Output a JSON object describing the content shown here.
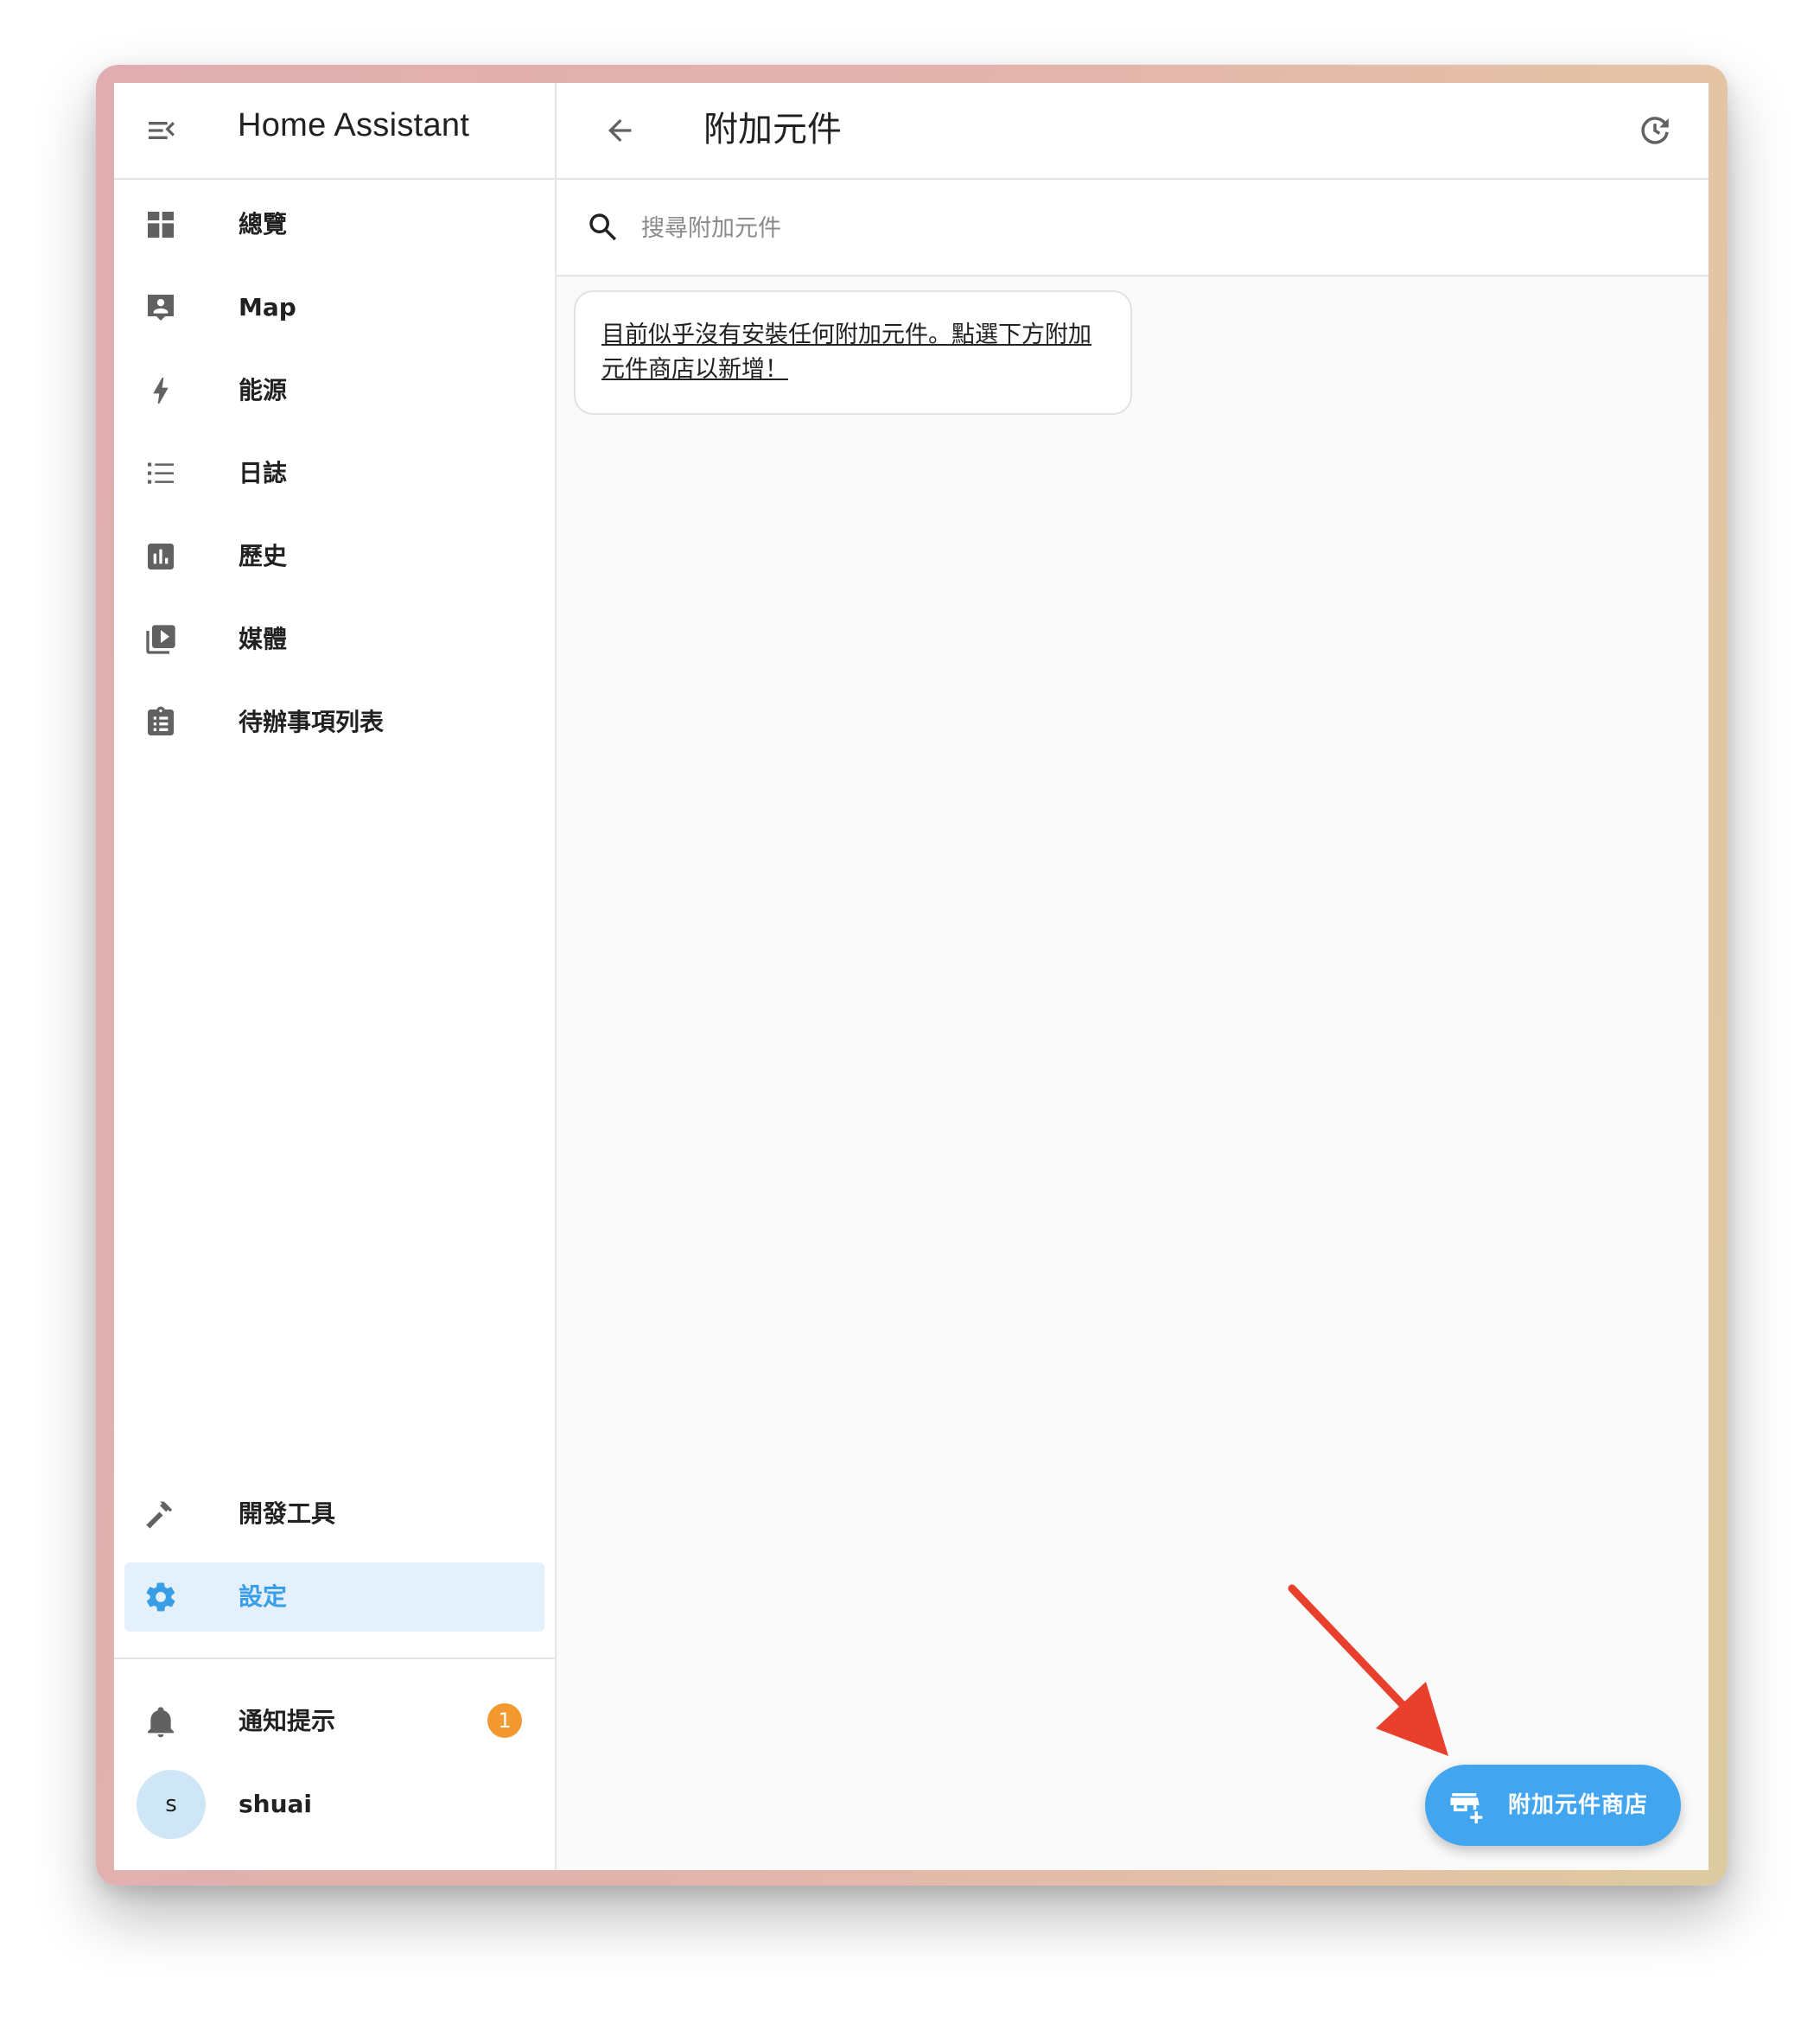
{
  "sidebar": {
    "title": "Home Assistant",
    "items": [
      {
        "label": "總覽",
        "icon": "dashboard-icon"
      },
      {
        "label": "Map",
        "icon": "map-account-icon"
      },
      {
        "label": "能源",
        "icon": "lightning-bolt-icon"
      },
      {
        "label": "日誌",
        "icon": "format-list-bulleted-icon"
      },
      {
        "label": "歷史",
        "icon": "chart-box-icon"
      },
      {
        "label": "媒體",
        "icon": "play-box-multiple-icon"
      },
      {
        "label": "待辦事項列表",
        "icon": "clipboard-list-icon"
      }
    ],
    "bottom_items": [
      {
        "label": "開發工具",
        "icon": "hammer-icon"
      },
      {
        "label": "設定",
        "icon": "cog-icon",
        "active": true
      }
    ],
    "notifications": {
      "label": "通知提示",
      "count": "1"
    },
    "user": {
      "initial": "s",
      "name": "shuai"
    }
  },
  "main": {
    "title": "附加元件",
    "search_placeholder": "搜尋附加元件",
    "empty_message": "目前似乎沒有安裝任何附加元件。點選下方附加元件商店以新增！",
    "fab_label": "附加元件商店"
  },
  "colors": {
    "accent": "#42a5ef",
    "active_bg": "#e4f0fb",
    "badge": "#f29a30",
    "annotation_arrow": "#e8402c"
  }
}
